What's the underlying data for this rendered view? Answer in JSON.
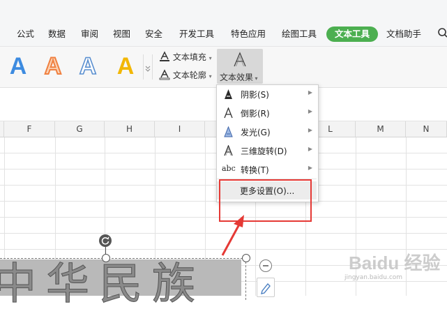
{
  "tabs": [
    {
      "label": "公式"
    },
    {
      "label": "数据"
    },
    {
      "label": "审阅"
    },
    {
      "label": "视图"
    },
    {
      "label": "安全"
    },
    {
      "label": "开发工具"
    },
    {
      "label": "特色应用"
    },
    {
      "label": "绘图工具"
    },
    {
      "label": "文本工具",
      "active": true
    },
    {
      "label": "文档助手"
    }
  ],
  "ribbon": {
    "style_glyph": "A",
    "style_colors": [
      "#3d8be0",
      "#f08040",
      "#5a8fd0",
      "#f2b705"
    ],
    "text_fill": "文本填充",
    "text_outline": "文本轮廓",
    "text_effects": "文本效果"
  },
  "columns": [
    "F",
    "G",
    "H",
    "I",
    "",
    "",
    "L",
    "M",
    "N"
  ],
  "effects_menu": {
    "items": [
      {
        "icon": "shadow-a-icon",
        "label": "阴影(S)"
      },
      {
        "icon": "reflection-a-icon",
        "label": "倒影(R)"
      },
      {
        "icon": "glow-a-icon",
        "label": "发光(G)"
      },
      {
        "icon": "3d-rotation-a-icon",
        "label": "三维旋转(D)"
      },
      {
        "icon": "transform-abc-icon",
        "icon_text": "abc",
        "label": "转换(T)"
      }
    ],
    "more_settings": "更多设置(O)..."
  },
  "wordart": {
    "text": "中华民族"
  },
  "watermark": {
    "text": "Baidu 经验",
    "url": "jingyan.baidu.com"
  },
  "colors": {
    "accent_tab": "#4caf50",
    "highlight": "#e53935"
  }
}
